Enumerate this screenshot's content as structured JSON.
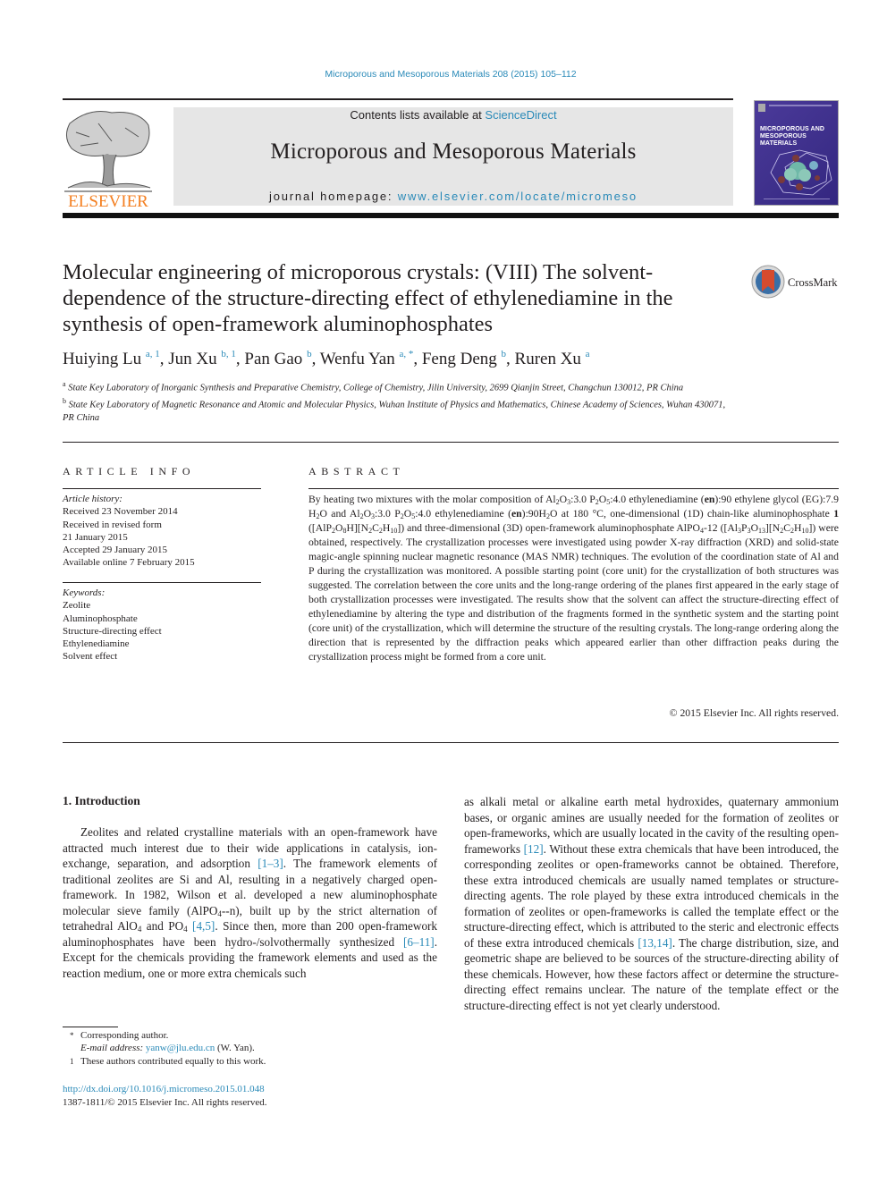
{
  "header": {
    "journal_ref": "Microporous and Mesoporous Materials 208 (2015) 105–112",
    "contents_prefix": "Contents lists available at ",
    "contents_link": "ScienceDirect",
    "journal_title": "Microporous and Mesoporous Materials",
    "homepage_prefix": "journal homepage: ",
    "homepage_link": "www.elsevier.com/locate/micromeso",
    "publisher_logo_text": "ELSEVIER",
    "cover_title_line1": "MICROPOROUS AND",
    "cover_title_line2": "MESOPOROUS MATERIALS",
    "crossmark_label": "CrossMark",
    "colors": {
      "link": "#2a8ab8",
      "elsevier_orange": "#f47f20",
      "cover_purple": "#3d2f8a"
    }
  },
  "article": {
    "title": "Molecular engineering of microporous crystals: (VIII) The solvent-dependence of the structure-directing effect of ethylenediamine in the synthesis of open-framework aluminophosphates",
    "authors": [
      {
        "name": "Huiying Lu",
        "sup": "a, 1"
      },
      {
        "name": "Jun Xu",
        "sup": "b, 1"
      },
      {
        "name": "Pan Gao",
        "sup": "b"
      },
      {
        "name": "Wenfu Yan",
        "sup": "a, *"
      },
      {
        "name": "Feng Deng",
        "sup": "b"
      },
      {
        "name": "Ruren Xu",
        "sup": "a"
      }
    ],
    "affiliations": [
      {
        "mark": "a",
        "text": "State Key Laboratory of Inorganic Synthesis and Preparative Chemistry, College of Chemistry, Jilin University, 2699 Qianjin Street, Changchun 130012, PR China"
      },
      {
        "mark": "b",
        "text": "State Key Laboratory of Magnetic Resonance and Atomic and Molecular Physics, Wuhan Institute of Physics and Mathematics, Chinese Academy of Sciences, Wuhan 430071, PR China"
      }
    ]
  },
  "article_info": {
    "heading": "ARTICLE INFO",
    "history_label": "Article history:",
    "history": [
      "Received 23 November 2014",
      "Received in revised form",
      "21 January 2015",
      "Accepted 29 January 2015",
      "Available online 7 February 2015"
    ],
    "keywords_label": "Keywords:",
    "keywords": [
      "Zeolite",
      "Aluminophosphate",
      "Structure-directing effect",
      "Ethylenediamine",
      "Solvent effect"
    ]
  },
  "abstract": {
    "heading": "ABSTRACT",
    "p1": "By heating two mixtures with the molar composition of Al",
    "text_rest": "The crystallization processes were investigated using powder X-ray diffraction (XRD) and solid-state magic-angle spinning nuclear magnetic resonance (MAS NMR) techniques. The evolution of the coordination state of Al and P during the crystallization was monitored. A possible starting point (core unit) for the crystallization of both structures was suggested. The correlation between the core units and the long-range ordering of the planes first appeared in the early stage of both crystallization processes were investigated. The results show that the solvent can affect the structure-directing effect of ethylenedi­amine by altering the type and distribution of the fragments formed in the synthetic system and the starting point (core unit) of the crystallization, which will determine the structure of the resulting crystals. The long-range ordering along the direction that is represented by the diffraction peaks which appeared earlier than other diffraction peaks during the crystallization process might be formed from a core unit.",
    "copyright": "© 2015 Elsevier Inc. All rights reserved."
  },
  "introduction": {
    "heading": "1.  Introduction",
    "left_seg1": "Zeolites and related crystalline materials with an open-framework have attracted much interest due to their wide appli­cations in catalysis, ion-exchange, separation, and adsorption ",
    "cite1": "[1–3]",
    "left_seg2": ". The framework elements of traditional zeolites are Si and Al, resulting in a negatively charged open-framework. In 1982, Wilson et al. developed a new aluminophosphate molecular sieve family (AlPO",
    "left_seg3": "-n), built up by the strict alternation of tetrahedral AlO",
    "left_seg4": " and PO",
    "cite2": "[4,5]",
    "left_seg5": ". Since then, more than 200 open-framework alumi­nophosphates have been hydro-/solvothermally synthesized ",
    "cite3": "[6–11]",
    "left_seg6": ". Except for the chemicals providing the framework elements and used as the reaction medium, one or more extra chemicals such",
    "right_seg1": "as alkali metal or alkaline earth metal hydroxides, quaternary ammonium bases, or organic amines are usually needed for the formation of zeolites or open-frameworks, which are usually located in the cavity of the resulting open-frameworks ",
    "cite4": "[12]",
    "right_seg2": ". Without these extra chemicals that have been introduced, the corresponding zeolites or open-frameworks cannot be obtained. Therefore, these extra introduced chemicals are usually named templates or structure-directing agents. The role played by these extra introduced chemicals in the formation of zeolites or open-frameworks is called the template effect or the structure-directing effect, which is attributed to the steric and electronic ef­fects of these extra introduced chemicals ",
    "cite5": "[13,14]",
    "right_seg3": ". The charge dis­tribution, size, and geometric shape are believed to be sources of the structure-directing ability of these chemicals. However, how these factors affect or determine the structure-directing effect re­mains unclear. The nature of the template effect or the structure-directing effect is not yet clearly understood."
  },
  "footnotes": {
    "corresponding_mark": "*",
    "corresponding": "Corresponding author.",
    "email_label": "E-mail address: ",
    "email": "yanw@jlu.edu.cn",
    "email_suffix": " (W. Yan).",
    "equal_mark": "1",
    "equal": "These authors contributed equally to this work.",
    "doi": "http://dx.doi.org/10.1016/j.micromeso.2015.01.048",
    "issn": "1387-1811/© 2015 Elsevier Inc. All rights reserved."
  }
}
